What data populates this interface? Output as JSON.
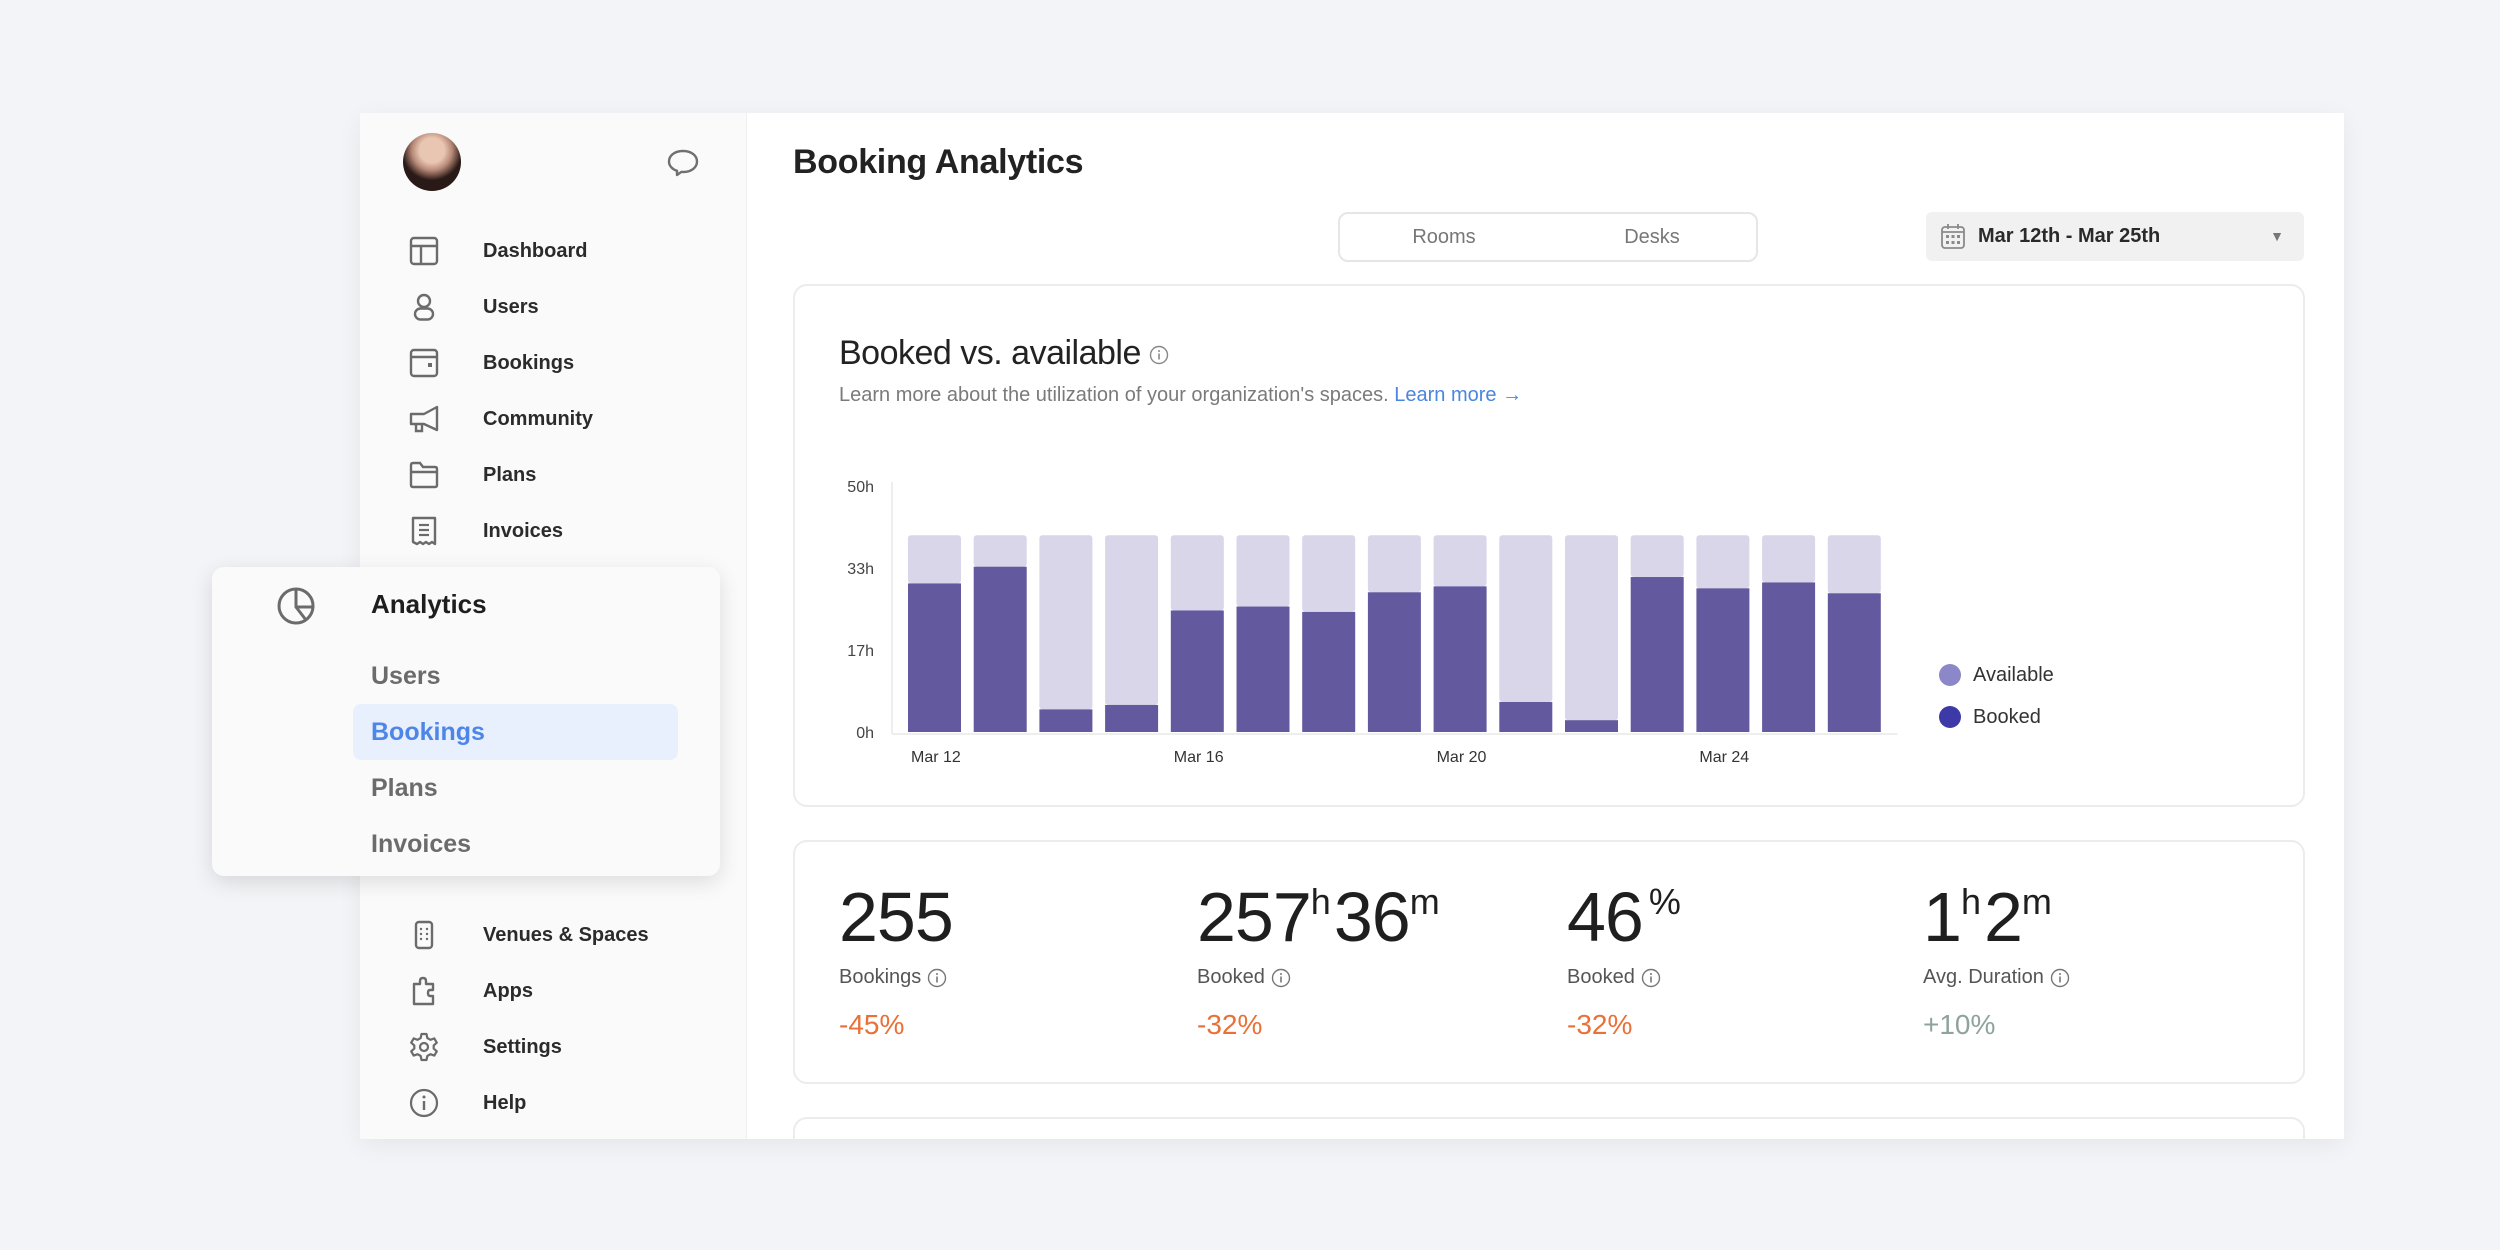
{
  "sidebar": {
    "avatar_alt": "User avatar",
    "items_top": [
      {
        "label": "Dashboard",
        "icon": "layout-icon"
      },
      {
        "label": "Users",
        "icon": "user-icon"
      },
      {
        "label": "Bookings",
        "icon": "calendar-card-icon"
      },
      {
        "label": "Community",
        "icon": "megaphone-icon"
      },
      {
        "label": "Plans",
        "icon": "folder-icon"
      },
      {
        "label": "Invoices",
        "icon": "receipt-icon"
      }
    ],
    "items_bottom": [
      {
        "label": "Venues & Spaces",
        "icon": "building-icon"
      },
      {
        "label": "Apps",
        "icon": "puzzle-icon"
      },
      {
        "label": "Settings",
        "icon": "gear-icon"
      },
      {
        "label": "Help",
        "icon": "info-icon"
      }
    ]
  },
  "flyout": {
    "title": "Analytics",
    "icon": "pie-chart-icon",
    "items": [
      {
        "label": "Users",
        "active": false
      },
      {
        "label": "Bookings",
        "active": true
      },
      {
        "label": "Plans",
        "active": false
      },
      {
        "label": "Invoices",
        "active": false
      }
    ]
  },
  "header": {
    "title": "Booking Analytics",
    "segments": [
      "Rooms",
      "Desks"
    ],
    "date_range": "Mar 12th - Mar 25th"
  },
  "chart_card": {
    "title": "Booked vs. available",
    "subtitle": "Learn more about the utilization of your organization's spaces.",
    "link": "Learn more →"
  },
  "chart_data": {
    "type": "bar",
    "stacked": true,
    "title": "Booked vs. available",
    "xlabel": "",
    "ylabel": "",
    "ylim": [
      0,
      50
    ],
    "yticks": [
      "0h",
      "17h",
      "33h",
      "50h"
    ],
    "ytick_values": [
      0,
      16.67,
      33.33,
      50
    ],
    "categories": [
      "Mar 12",
      "Mar 13",
      "Mar 14",
      "Mar 15",
      "Mar 16",
      "Mar 17",
      "Mar 18",
      "Mar 19",
      "Mar 20",
      "Mar 21",
      "Mar 22",
      "Mar 23",
      "Mar 24",
      "Mar 25",
      "Mar 26"
    ],
    "xtick_labels": {
      "0": "Mar 12",
      "4": "Mar 16",
      "8": "Mar 20",
      "12": "Mar 24"
    },
    "total_capacity_hours": 40,
    "series": [
      {
        "name": "Booked",
        "color": "#63599e",
        "values": [
          30.2,
          33.6,
          4.6,
          5.5,
          24.7,
          25.5,
          24.4,
          28.4,
          29.6,
          6.1,
          2.4,
          31.5,
          29.2,
          30.4,
          28.2
        ]
      },
      {
        "name": "Available",
        "color": "#d9d6ea",
        "values": [
          9.8,
          6.4,
          35.4,
          34.5,
          15.3,
          14.5,
          15.6,
          11.6,
          10.4,
          33.9,
          37.6,
          8.5,
          10.8,
          9.6,
          11.8
        ]
      }
    ],
    "legend": [
      {
        "name": "Available",
        "color": "#8c87c8"
      },
      {
        "name": "Booked",
        "color": "#3d3aa8"
      }
    ],
    "legend_position": "right",
    "grid": false
  },
  "stats": [
    {
      "value": "255",
      "unit1": "",
      "value2": "",
      "unit2": "",
      "label": "Bookings",
      "delta": "-45%",
      "trend": "neg"
    },
    {
      "value": "257",
      "unit1": "h",
      "value2": "36",
      "unit2": "m",
      "label": "Booked",
      "delta": "-32%",
      "trend": "neg"
    },
    {
      "value": "46",
      "unit1": "%",
      "value2": "",
      "unit2": "",
      "label": "Booked",
      "delta": "-32%",
      "trend": "neg"
    },
    {
      "value": "1",
      "unit1": "h",
      "value2": "2",
      "unit2": "m",
      "label": "Avg. Duration",
      "delta": "+10%",
      "trend": "pos"
    }
  ]
}
